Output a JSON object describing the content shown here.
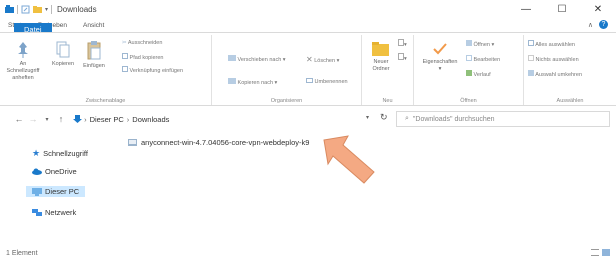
{
  "window": {
    "title": "Downloads",
    "minimize": "—",
    "maximize": "☐",
    "close": "✕"
  },
  "ribbon_tabs": {
    "file": "Datei",
    "start": "Start",
    "share": "Freigeben",
    "view": "Ansicht"
  },
  "clipboard": {
    "pin": "An Schnellzugriff anheften",
    "copy": "Kopieren",
    "paste": "Einfügen",
    "cut": "Ausschneiden",
    "copy_path": "Pfad kopieren",
    "paste_shortcut": "Verknüpfung einfügen",
    "label": "Zwischenablage"
  },
  "organize": {
    "move_to": "Verschieben nach",
    "copy_to": "Kopieren nach",
    "delete": "Löschen",
    "rename": "Umbenennen",
    "label": "Organisieren"
  },
  "new": {
    "new_folder": "Neuer Ordner",
    "label": "Neu"
  },
  "open": {
    "properties": "Eigenschaften",
    "open": "Öffnen",
    "edit": "Bearbeiten",
    "history": "Verlauf",
    "label": "Öffnen"
  },
  "select": {
    "select_all": "Alles auswählen",
    "select_none": "Nichts auswählen",
    "invert": "Auswahl umkehren",
    "label": "Auswählen"
  },
  "address": {
    "root": "Dieser PC",
    "folder": "Downloads",
    "search_placeholder": "\"Downloads\" durchsuchen"
  },
  "nav": {
    "quick_access": "Schnellzugriff",
    "onedrive": "OneDrive",
    "this_pc": "Dieser PC",
    "network": "Netzwerk"
  },
  "files": [
    {
      "name": "anyconnect-win-4.7.04056-core-vpn-webdeploy-k9"
    }
  ],
  "status": {
    "count": "1 Element"
  },
  "colors": {
    "accent": "#1979ca",
    "selected": "#cce8ff",
    "pointer_arrow": "#f4a983"
  }
}
